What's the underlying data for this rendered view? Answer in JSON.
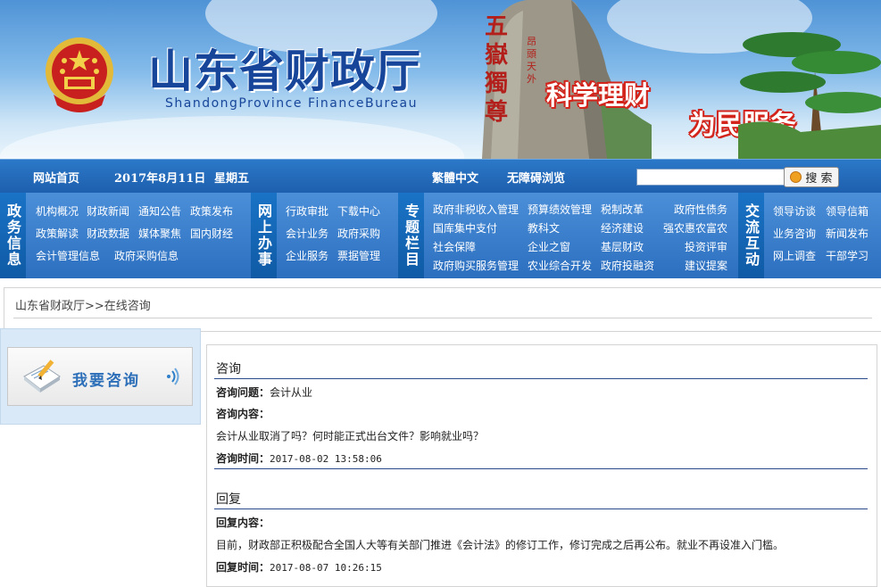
{
  "header": {
    "title": "山东省财政厅",
    "subtitle": "ShandongProvince  FinanceBureau",
    "slogan_1": "科学理财",
    "slogan_2": "为民服务",
    "rock_text": "五嶽獨尊",
    "rock_small": "昂頭天外"
  },
  "navbar": {
    "home": "网站首页",
    "date": "2017年8月11日",
    "weekday": "星期五",
    "traditional": "繁體中文",
    "accessible": "无障碍浏览",
    "search_button": "搜 索",
    "search_value": ""
  },
  "menu": {
    "sections": [
      {
        "label": "政务信息",
        "items": [
          "机构概况",
          "财政新闻",
          "通知公告",
          "政策发布",
          "政策解读",
          "财政数据",
          "媒体聚焦",
          "国内财经",
          "会计管理信息",
          "政府采购信息"
        ]
      },
      {
        "label": "网上办事",
        "items": [
          "行政审批",
          "下载中心",
          "会计业务",
          "政府采购",
          "企业服务",
          "票据管理"
        ]
      },
      {
        "label": "专题栏目",
        "items": [
          "政府非税收入管理",
          "预算绩效管理",
          "税制改革",
          "政府性债务",
          "国库集中支付",
          "教科文",
          "经济建设",
          "强农惠农富农",
          "社会保障",
          "企业之窗",
          "基层财政",
          "投资评审",
          "政府购买服务管理",
          "农业综合开发",
          "政府投融资",
          "建议提案"
        ]
      },
      {
        "label": "交流互动",
        "items": [
          "领导访谈",
          "领导信箱",
          "业务咨询",
          "新闻发布",
          "网上调查",
          "干部学习"
        ]
      }
    ]
  },
  "breadcrumb": "山东省财政厅>>在线咨询",
  "sidebar": {
    "ask_button": "我要咨询"
  },
  "consult": {
    "title": "咨询",
    "question_label": "咨询问题：",
    "question": "会计从业",
    "content_label": "咨询内容：",
    "content": "会计从业取消了吗？何时能正式出台文件？影响就业吗？",
    "time_label": "咨询时间：",
    "time": "2017-08-02 13:58:06"
  },
  "reply": {
    "title": "回复",
    "content_label": "回复内容：",
    "content": "目前，财政部正积极配合全国人大等有关部门推进《会计法》的修订工作，修订完成之后再公布。就业不再设准入门槛。",
    "time_label": "回复时间：",
    "time": "2017-08-07 10:26:15"
  },
  "colors": {
    "brand_blue": "#17459a",
    "nav_blue": "#1d5fae",
    "slogan_red": "#d3241c"
  }
}
